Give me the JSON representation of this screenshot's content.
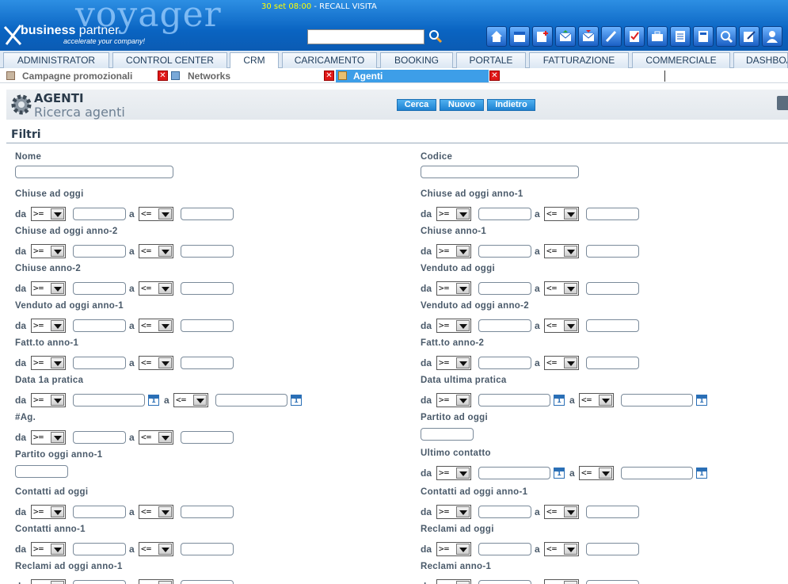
{
  "app": {
    "logo": "voyager",
    "brand_bold": "business",
    "brand_light": " partner",
    "tagline": "accelerate your company!"
  },
  "recall": {
    "datetime": "30 set 08:00",
    "text": " - RECALL VISITA"
  },
  "search": {
    "placeholder": ""
  },
  "main_tabs": [
    "ADMINISTRATOR",
    "CONTROL CENTER",
    "CRM",
    "CARICAMENTO",
    "BOOKING",
    "PORTALE",
    "FATTURAZIONE",
    "COMMERCIALE",
    "DASHBOARD"
  ],
  "sub_tabs": [
    "Campagne promozionali",
    "Networks",
    "Agenti"
  ],
  "page": {
    "title": "AGENTI",
    "subtitle": "Ricerca agenti"
  },
  "buttons": {
    "search": "Cerca",
    "new": "Nuovo",
    "back": "Indietro"
  },
  "filters_title": "Filtri",
  "words": {
    "from": "da",
    "to": "a"
  },
  "operators": {
    "from": ">=",
    "to": "<="
  },
  "cal_day": "1",
  "fields": {
    "nome": "Nome",
    "codice": "Codice",
    "chiuse_oggi": "Chiuse ad oggi",
    "chiuse_oggi_a1": "Chiuse ad oggi anno-1",
    "chiuse_oggi_a2": "Chiuse ad oggi anno-2",
    "chiuse_a1": "Chiuse anno-1",
    "chiuse_a2": "Chiuse anno-2",
    "venduto_oggi": "Venduto ad oggi",
    "venduto_oggi_a1": "Venduto ad oggi anno-1",
    "venduto_oggi_a2": "Venduto ad oggi anno-2",
    "fatt_a1": "Fatt.to anno-1",
    "fatt_a2": "Fatt.to anno-2",
    "data_prima": "Data 1a pratica",
    "data_ultima": "Data ultima pratica",
    "n_ag": "#Ag.",
    "partito_oggi": "Partito ad oggi",
    "partito_oggi_a1": "Partito oggi anno-1",
    "ultimo_contatto": "Ultimo contatto",
    "contatti_oggi": "Contatti ad oggi",
    "contatti_oggi_a1": "Contatti ad oggi anno-1",
    "contatti_a1": "Contatti anno-1",
    "reclami_oggi": "Reclami ad oggi",
    "reclami_oggi_a1": "Reclami ad oggi anno-1",
    "reclami_a1": "Reclami anno-1"
  }
}
